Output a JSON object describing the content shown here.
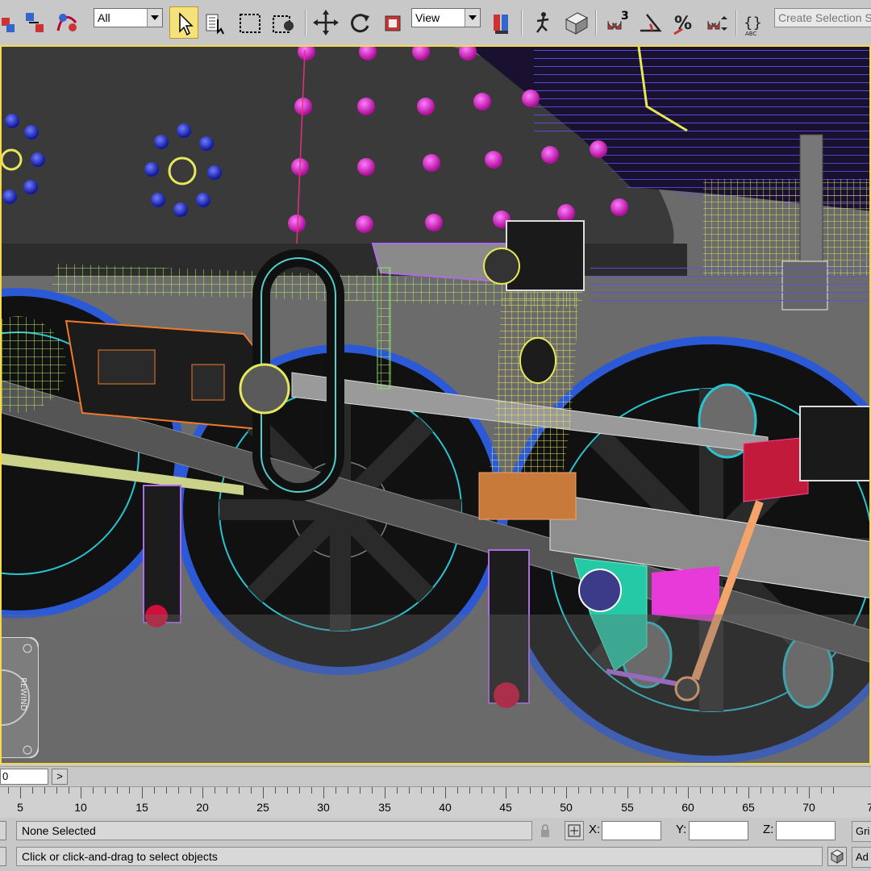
{
  "toolbar": {
    "selection_filter": "All",
    "reference_coord": "View",
    "named_selection_placeholder": "Create Selection Se",
    "snap_angle_label": "3",
    "percent_snap_label": "%",
    "edit_named_sel_label": "ABC"
  },
  "viewport": {
    "navigation_wheel_label": "REWIND",
    "border_color": "#f4d94a"
  },
  "time_slider": {
    "current_frame": "0",
    "next_label": ">"
  },
  "track_bar": {
    "ticks": [
      "5",
      "10",
      "15",
      "20",
      "25",
      "30",
      "35",
      "40",
      "45",
      "50",
      "55",
      "60",
      "65",
      "70",
      "7"
    ]
  },
  "status": {
    "selection_text": "None Selected",
    "prompt_text": "Click or click-and-drag to select objects",
    "x_label": "X:",
    "y_label": "Y:",
    "z_label": "Z:",
    "x_value": "",
    "y_value": "",
    "z_value": "",
    "grid_button": "Gri",
    "add_key_button": "Ad"
  }
}
